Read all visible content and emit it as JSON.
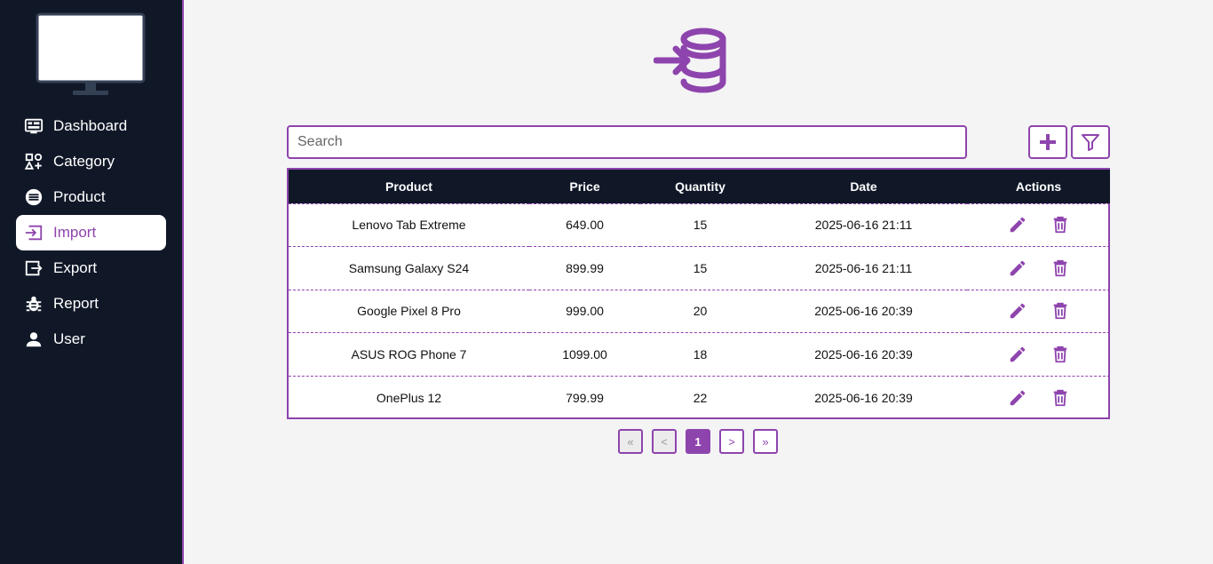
{
  "sidebar": {
    "items": [
      {
        "label": "Dashboard",
        "icon": "dashboard-icon"
      },
      {
        "label": "Category",
        "icon": "category-icon"
      },
      {
        "label": "Product",
        "icon": "product-icon"
      },
      {
        "label": "Import",
        "icon": "import-icon",
        "active": true
      },
      {
        "label": "Export",
        "icon": "export-icon"
      },
      {
        "label": "Report",
        "icon": "bug-icon"
      },
      {
        "label": "User",
        "icon": "user-icon"
      }
    ]
  },
  "search": {
    "placeholder": "Search",
    "value": ""
  },
  "table": {
    "headers": [
      "Product",
      "Price",
      "Quantity",
      "Date",
      "Actions"
    ],
    "rows": [
      {
        "product": "Lenovo Tab Extreme",
        "price": "649.00",
        "quantity": "15",
        "date": "2025-06-16 21:11"
      },
      {
        "product": "Samsung Galaxy S24",
        "price": "899.99",
        "quantity": "15",
        "date": "2025-06-16 21:11"
      },
      {
        "product": "Google Pixel 8 Pro",
        "price": "999.00",
        "quantity": "20",
        "date": "2025-06-16 20:39"
      },
      {
        "product": "ASUS ROG Phone 7",
        "price": "1099.00",
        "quantity": "18",
        "date": "2025-06-16 20:39"
      },
      {
        "product": "OnePlus 12",
        "price": "799.99",
        "quantity": "22",
        "date": "2025-06-16 20:39"
      }
    ]
  },
  "pagination": {
    "first": "«",
    "prev": "<",
    "current": "1",
    "next": ">",
    "last": "»"
  },
  "colors": {
    "accent": "#8e44ad",
    "sidebar_bg": "#101828",
    "page_bg": "#f4f4f5"
  }
}
